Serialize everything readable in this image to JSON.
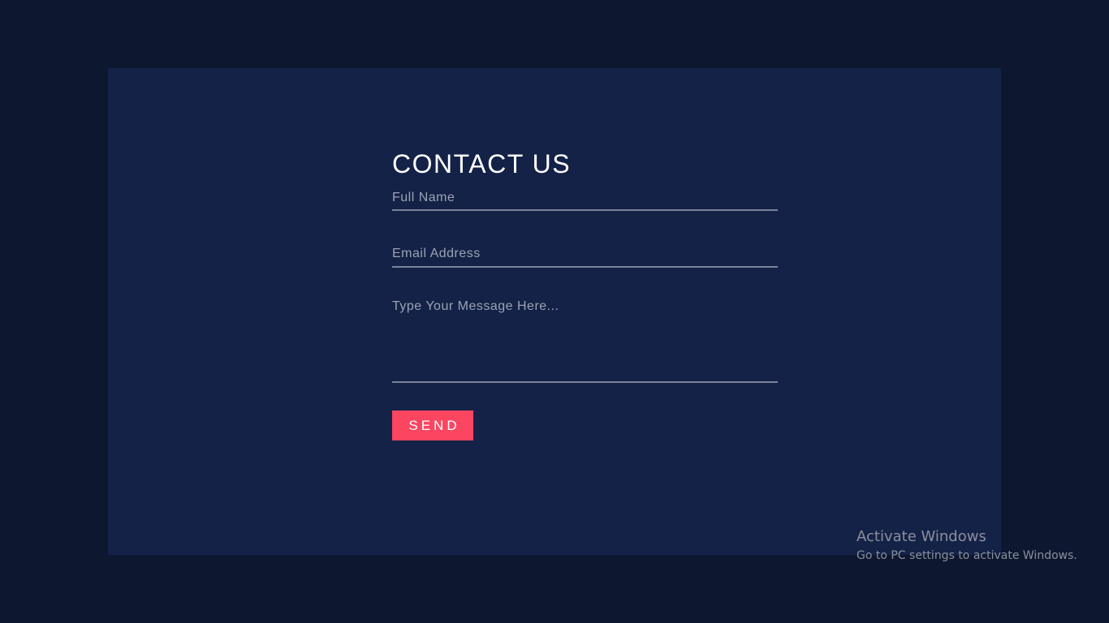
{
  "contact_form": {
    "title": "CONTACT US",
    "name_placeholder": "Full Name",
    "email_placeholder": "Email Address",
    "message_placeholder": "Type Your Message Here...",
    "send_label": "SEND"
  },
  "watermark": {
    "title": "Activate Windows",
    "subtitle": "Go to PC settings to activate Windows."
  },
  "colors": {
    "page_background": "#0d1730",
    "card_background": "#142247",
    "accent": "#fc4561",
    "field_line": "#7a8399",
    "title_text": "#ffffff"
  }
}
